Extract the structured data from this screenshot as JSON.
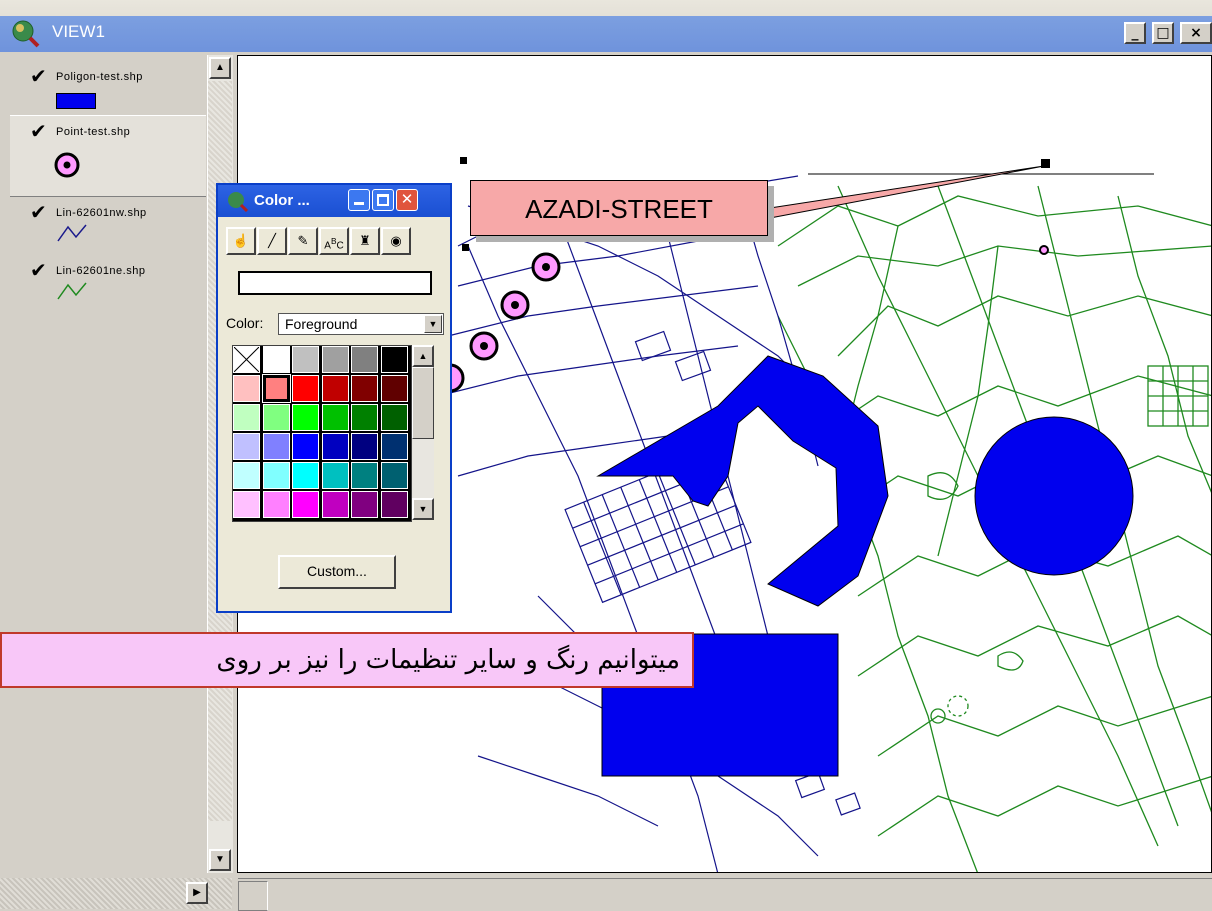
{
  "window": {
    "title": "VIEW1",
    "minimize": "_",
    "maximize": "□",
    "close": "×"
  },
  "toc": {
    "layers": [
      {
        "name": "Poligon-test.shp",
        "checked": true,
        "symbol": "polygon",
        "color": "#0000ee"
      },
      {
        "name": "Point-test.shp",
        "checked": true,
        "symbol": "point",
        "color": "#ff99ff"
      },
      {
        "name": "Lin-62601nw.shp",
        "checked": true,
        "symbol": "line",
        "color": "#1a1a8c"
      },
      {
        "name": "Lin-62601ne.shp",
        "checked": true,
        "symbol": "line",
        "color": "#1f8a1f"
      }
    ]
  },
  "palette": {
    "title": "Color ...",
    "color_label": "Color:",
    "color_value": "Foreground",
    "custom_label": "Custom...",
    "tools": [
      "hand-icon",
      "pen-icon",
      "marker-icon",
      "text-abc-icon",
      "paint-bucket-icon",
      "palette-icon"
    ],
    "colors": [
      [
        "none",
        "#ffffff",
        "#c0c0c0",
        "#a0a0a0",
        "#808080",
        "#000000"
      ],
      [
        "#ffc0c0",
        "#ff8080",
        "#ff0000",
        "#c00000",
        "#800000",
        "#600000"
      ],
      [
        "#c0ffc0",
        "#80ff80",
        "#00ff00",
        "#00c000",
        "#008000",
        "#006000"
      ],
      [
        "#c0c0ff",
        "#8080ff",
        "#0000ff",
        "#0000c0",
        "#000080",
        "#003070"
      ],
      [
        "#c0ffff",
        "#80ffff",
        "#00ffff",
        "#00c0c0",
        "#008080",
        "#006070"
      ],
      [
        "#ffc0ff",
        "#ff80ff",
        "#ff00ff",
        "#c000c0",
        "#800080",
        "#600060"
      ]
    ]
  },
  "map": {
    "street_label": "AZADI-STREET",
    "caption": "میتوانیم رنگ و سایر تنظیمات  را نیز بر روی"
  }
}
